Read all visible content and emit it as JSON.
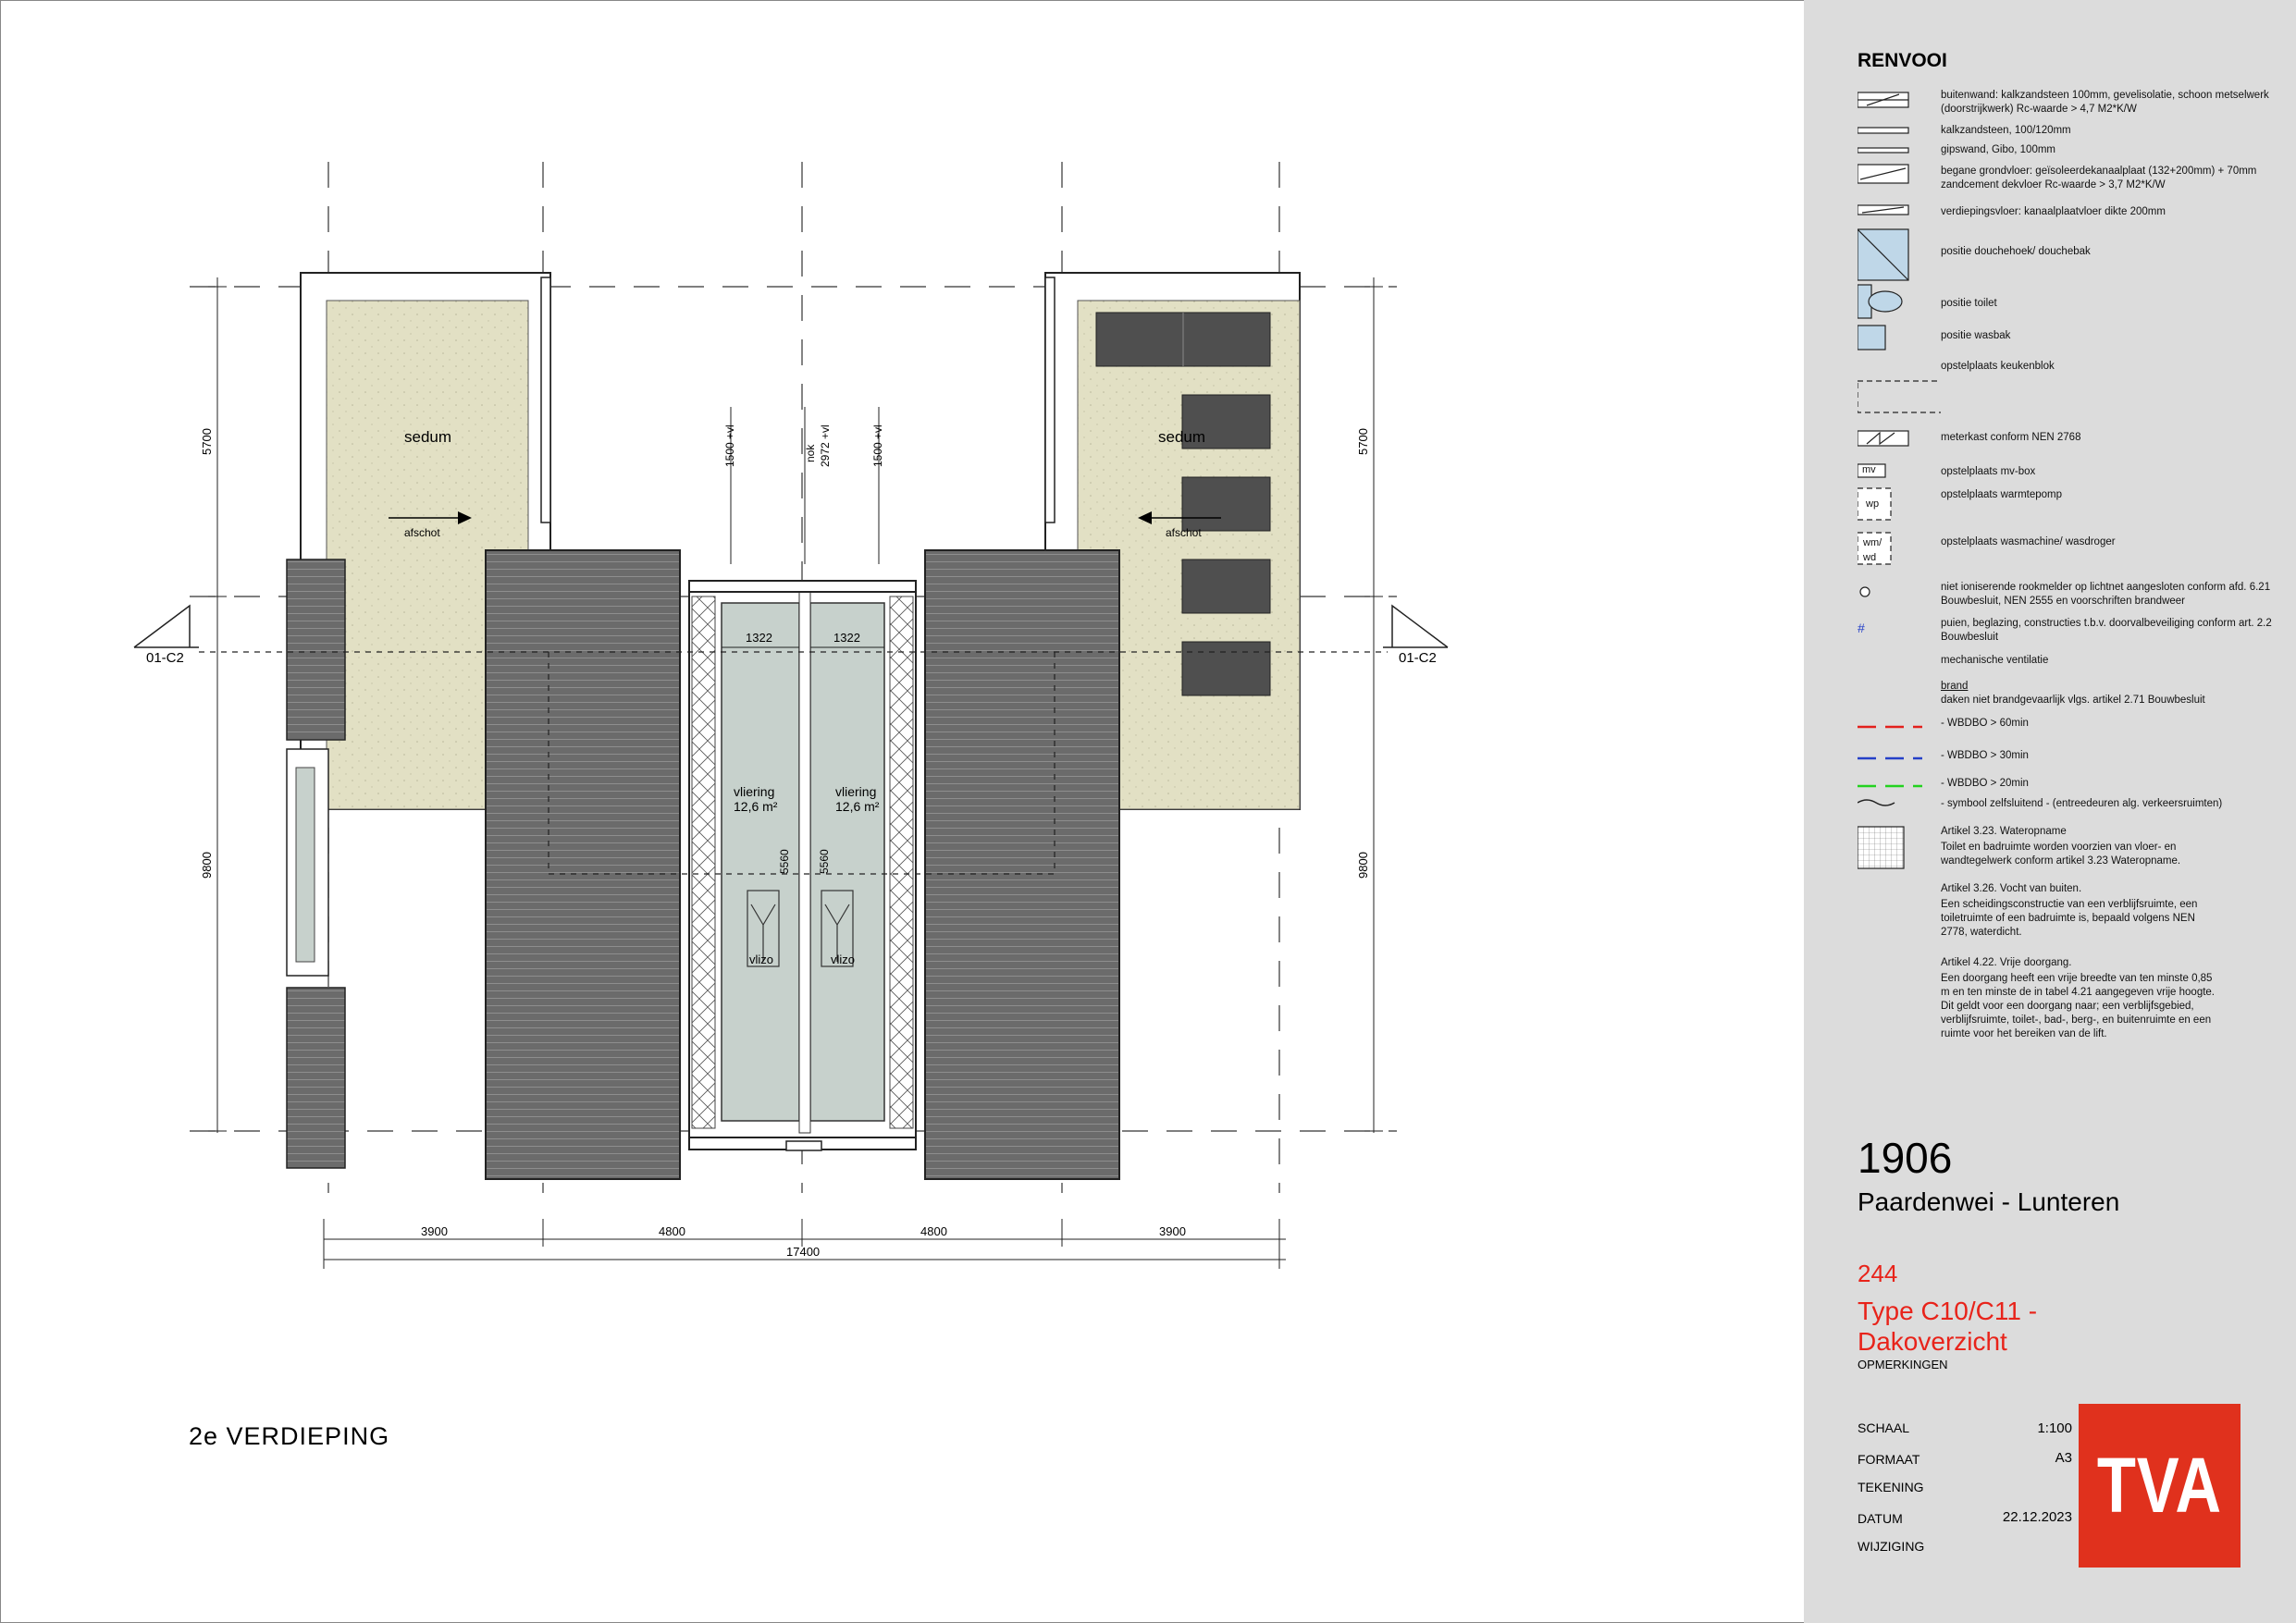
{
  "floor_label": "2e VERDIEPING",
  "plan": {
    "sedum_label": "sedum",
    "afschot_label": "afschot",
    "section_marker": "01-C2",
    "vliering_label": "vliering",
    "vliering_area": "12,6 m²",
    "vlizo_label": "vlizo",
    "dim_1322": "1322",
    "dim_5560": "5560",
    "height_left": "1500 +vl",
    "height_nok": "nok",
    "height_nok_value": "2972 +vl",
    "height_right": "1500 +vl",
    "dim_5700": "5700",
    "dim_9800": "9800",
    "bottom_dims": [
      "3900",
      "4800",
      "4800",
      "3900"
    ],
    "total_dim": "17400"
  },
  "legend": {
    "title": "RENVOOI",
    "items": [
      "buitenwand: kalkzandsteen 100mm, gevelisolatie, schoon metselwerk (doorstrijkwerk) Rc-waarde > 4,7 M2*K/W",
      "kalkzandsteen, 100/120mm",
      "gipswand, Gibo, 100mm",
      "begane grondvloer: geïsoleerdekanaalplaat (132+200mm) + 70mm zandcement dekvloer Rc-waarde > 3,7 M2*K/W",
      "verdiepingsvloer: kanaalplaatvloer dikte 200mm",
      "positie douchehoek/ douchebak",
      "positie toilet",
      "positie wasbak",
      "opstelplaats keukenblok",
      "meterkast conform NEN 2768",
      "opstelplaats mv-box",
      "opstelplaats warmtepomp",
      "opstelplaats wasmachine/ wasdroger",
      "niet ioniserende rookmelder op lichtnet aangesloten conform afd. 6.21 Bouwbesluit, NEN 2555 en voorschriften brandweer",
      "puien, beglazing, constructies t.b.v. doorvalbeveiliging conform art. 2.2 Bouwbesluit",
      "mechanische ventilatie",
      "brand",
      "daken niet brandgevaarlijk vlgs. artikel 2.71 Bouwbesluit",
      "- WBDBO > 60min",
      "- WBDBO > 30min",
      "- WBDBO > 20min",
      "- symbool zelfsluitend - (entreedeuren alg. verkeersruimten)",
      "Artikel 3.23. Wateropname",
      "Toilet en badruimte worden voorzien van vloer- en wandtegelwerk conform artikel 3.23 Wateropname.",
      "Artikel 3.26. Vocht van buiten.",
      "Een scheidingsconstructie van een verblijfsruimte, een toiletruimte of een badruimte is, bepaald volgens NEN 2778, waterdicht.",
      "Artikel 4.22. Vrije doorgang.",
      "Een doorgang heeft een vrije breedte van ten minste 0,85 m en ten minste de in tabel 4.21 aangegeven vrije hoogte. Dit geldt voor een doorgang naar; een verblijfsgebied, verblijfsruimte, toilet-, bad-, berg-, en buitenruimte en een ruimte voor het bereiken van de lift."
    ],
    "symbols": {
      "mv": "mv",
      "wp": "wp",
      "wm": "wm/",
      "wd": "wd",
      "puien": "#"
    }
  },
  "titleblock": {
    "project_number": "1906",
    "project_name": "Paardenwei - Lunteren",
    "drawing_number": "244",
    "drawing_title_1": "Type C10/C11 -",
    "drawing_title_2": "Dakoverzicht",
    "opmerkingen": "OPMERKINGEN",
    "schaal_label": "SCHAAL",
    "schaal_value": "1:100",
    "formaat_label": "FORMAAT",
    "formaat_value": "A3",
    "tekening_label": "TEKENING",
    "datum_label": "DATUM",
    "datum_value": "22.12.2023",
    "wijziging_label": "WIJZIGING",
    "logo": "TVA"
  },
  "colors": {
    "accent": "#e8231a",
    "logo_bg": "#e0311d",
    "sedum": "#e2e0c4",
    "roof": "#6e6e6e",
    "vliering": "#c7d1cc",
    "sidebar": "#dcdcdc"
  }
}
